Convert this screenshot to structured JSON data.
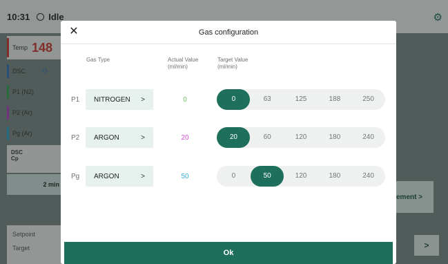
{
  "app": {
    "time": "10:31",
    "status": "Idle",
    "left_panel": {
      "temp_label": "Temp",
      "temp_value": "148",
      "dsc_label": "DSC",
      "dsc_value": "-0",
      "p1_label": "P1 (N2)",
      "p2_label": "P2 (Ar)",
      "pg_label": "Pg (Ar)",
      "block_line1": "DSC",
      "block_line2": "Cp",
      "block2_text": "2 min"
    },
    "setpoint": {
      "label": "Setpoint",
      "target_label": "Target"
    },
    "right_button_label": "ement >",
    "right_arrow_label": ">",
    "colors": {
      "accent": "#1e6f5c",
      "temp": "#d0342c",
      "dsc": "#2c6fbf",
      "p1": "#2aa84a",
      "p2": "#b23ac8",
      "pg": "#2a9dc8"
    }
  },
  "modal": {
    "title": "Gas configuration",
    "close_icon": "close-icon",
    "columns": {
      "gas_type": "Gas Type",
      "actual_value": "Actual Value",
      "actual_unit": "(ml/min)",
      "target_value": "Target Value",
      "target_unit": "(ml/min)"
    },
    "rows": [
      {
        "label": "P1",
        "gas": "NITROGEN",
        "chevron": ">",
        "actual": "0",
        "actual_color": "#6cc35a",
        "options": [
          "0",
          "63",
          "125",
          "188",
          "250"
        ],
        "selected": 0
      },
      {
        "label": "P2",
        "gas": "ARGON",
        "chevron": ">",
        "actual": "20",
        "actual_color": "#d34fd6",
        "options": [
          "20",
          "60",
          "120",
          "180",
          "240"
        ],
        "selected": 0
      },
      {
        "label": "Pg",
        "gas": "ARGON",
        "chevron": ">",
        "actual": "50",
        "actual_color": "#3ab0d8",
        "options": [
          "0",
          "50",
          "120",
          "180",
          "240"
        ],
        "selected": 1
      }
    ],
    "ok_label": "Ok"
  }
}
